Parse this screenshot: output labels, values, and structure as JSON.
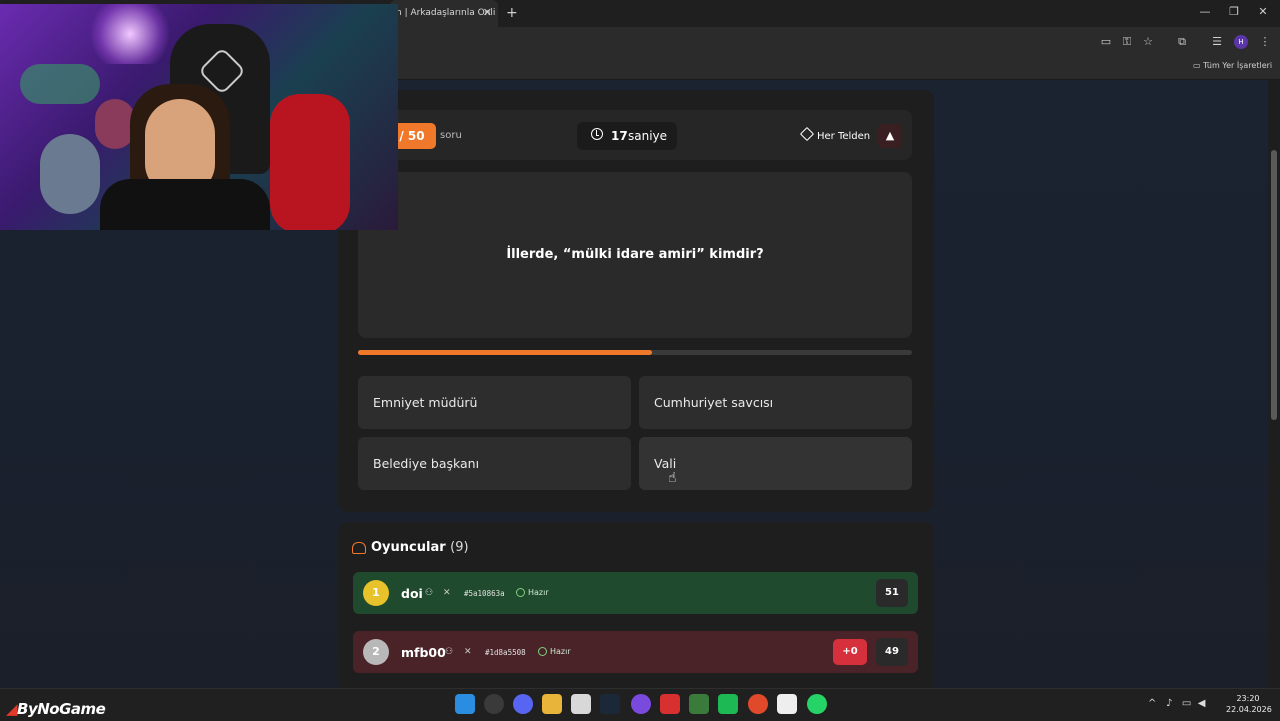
{
  "browser": {
    "tab_title": "n | Arkadaşlarınla Onli",
    "tab_close": "✕",
    "new_tab": "+",
    "minimize": "—",
    "restore": "❐",
    "close": "✕",
    "bookmarks_all": "Tüm Yer İşaretleri",
    "profile_initial": "H"
  },
  "game": {
    "question_counter": "/ 50",
    "question_counter_suffix": "soru",
    "timer_value": "17",
    "timer_unit": "saniye",
    "category": "Her Telden",
    "report_icon": "▲",
    "question": "İllerde, “mülki idare amiri” kimdir?",
    "progress_fraction": 0.53,
    "answers": [
      "Emniyet müdürü",
      "Cumhuriyet savcısı",
      "Belediye başkanı",
      "Vali"
    ]
  },
  "players": {
    "title": "Oyuncular",
    "count": "(9)",
    "list": [
      {
        "rank": "1",
        "name": "doi",
        "id": "#5a10863a",
        "status": "Hazır",
        "delta": "",
        "score": "51",
        "rank_color": "#e8c22a"
      },
      {
        "rank": "2",
        "name": "mfb00",
        "id": "#1d8a5508",
        "status": "Hazır",
        "delta": "+0",
        "score": "49",
        "rank_color": "#b8b8b8"
      }
    ]
  },
  "taskbar": {
    "brand_prefix": "",
    "brand": "ByNoGame",
    "time": "23:20",
    "date": "22.04.2026"
  },
  "colors": {
    "accent": "#f0782a",
    "correct_row": "#1f4a2d",
    "wrong_row": "#4a2328",
    "delta_badge": "#d6303d"
  }
}
